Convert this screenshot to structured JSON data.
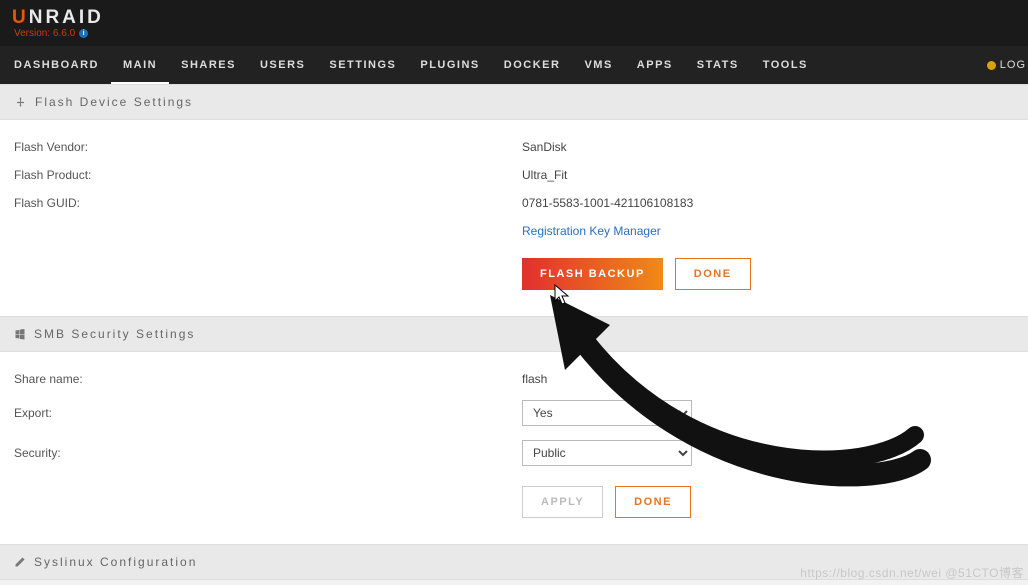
{
  "header": {
    "logo_prefix_accent": "U",
    "logo_rest": "NRAID",
    "version": "Version: 6.6.0"
  },
  "nav": {
    "items": [
      "DASHBOARD",
      "MAIN",
      "SHARES",
      "USERS",
      "SETTINGS",
      "PLUGINS",
      "DOCKER",
      "VMS",
      "APPS",
      "STATS",
      "TOOLS"
    ],
    "active_index": 1,
    "right_label": "LOG"
  },
  "sections": {
    "flash": {
      "title": "Flash Device Settings",
      "rows": {
        "vendor_label": "Flash Vendor:",
        "vendor_value": "SanDisk",
        "product_label": "Flash Product:",
        "product_value": "Ultra_Fit",
        "guid_label": "Flash GUID:",
        "guid_value": "0781-5583-1001-421106108183",
        "reg_link": "Registration Key Manager"
      },
      "buttons": {
        "backup": "FLASH BACKUP",
        "done": "DONE"
      }
    },
    "smb": {
      "title": "SMB Security Settings",
      "rows": {
        "share_label": "Share name:",
        "share_value": "flash",
        "export_label": "Export:",
        "export_value": "Yes",
        "security_label": "Security:",
        "security_value": "Public"
      },
      "buttons": {
        "apply": "APPLY",
        "done": "DONE"
      }
    },
    "syslinux": {
      "title": "Syslinux Configuration"
    }
  },
  "watermark": "https://blog.csdn.net/wei @51CTO博客"
}
